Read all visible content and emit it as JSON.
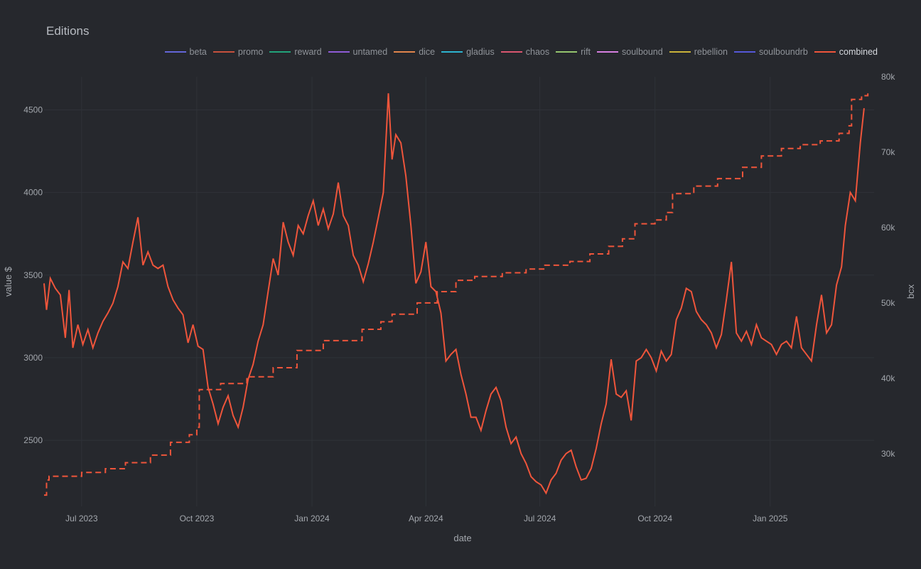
{
  "chart_data": {
    "type": "line",
    "title": "Editions",
    "xlabel": "date",
    "ylabel": "value $",
    "y2label": "bcx",
    "xlim": [
      "2023-06-01",
      "2025-03-25"
    ],
    "ylim": [
      2100,
      4700
    ],
    "y2lim": [
      23000,
      80000
    ],
    "x_ticks": [
      "Jul 2023",
      "Oct 2023",
      "Jan 2024",
      "Apr 2024",
      "Jul 2024",
      "Oct 2024",
      "Jan 2025"
    ],
    "y_ticks": [
      "2500",
      "3000",
      "3500",
      "4000",
      "4500"
    ],
    "y2_ticks": [
      "30k",
      "40k",
      "50k",
      "60k",
      "70k",
      "80k"
    ],
    "grid": true,
    "legend_position": "top-right",
    "legend": [
      {
        "name": "beta",
        "color": "#6366d8"
      },
      {
        "name": "promo",
        "color": "#c7513d"
      },
      {
        "name": "reward",
        "color": "#22a37a"
      },
      {
        "name": "untamed",
        "color": "#8e5bd6"
      },
      {
        "name": "dice",
        "color": "#e0844c"
      },
      {
        "name": "gladius",
        "color": "#2db3cf"
      },
      {
        "name": "chaos",
        "color": "#d9566f"
      },
      {
        "name": "rift",
        "color": "#94c46e"
      },
      {
        "name": "soulbound",
        "color": "#d67fe0"
      },
      {
        "name": "rebellion",
        "color": "#c9b23a"
      },
      {
        "name": "soulboundrb",
        "color": "#5558d8"
      },
      {
        "name": "combined",
        "color": "#ef553b"
      }
    ],
    "series": [
      {
        "name": "combined",
        "axis": "y",
        "style": "solid",
        "color": "#ef553b",
        "points": [
          [
            "2023-06-01",
            3450
          ],
          [
            "2023-06-03",
            3290
          ],
          [
            "2023-06-06",
            3480
          ],
          [
            "2023-06-10",
            3420
          ],
          [
            "2023-06-14",
            3380
          ],
          [
            "2023-06-18",
            3120
          ],
          [
            "2023-06-21",
            3410
          ],
          [
            "2023-06-24",
            3060
          ],
          [
            "2023-06-28",
            3200
          ],
          [
            "2023-07-02",
            3080
          ],
          [
            "2023-07-06",
            3170
          ],
          [
            "2023-07-10",
            3060
          ],
          [
            "2023-07-14",
            3150
          ],
          [
            "2023-07-18",
            3220
          ],
          [
            "2023-07-22",
            3270
          ],
          [
            "2023-07-26",
            3330
          ],
          [
            "2023-07-30",
            3430
          ],
          [
            "2023-08-03",
            3580
          ],
          [
            "2023-08-07",
            3540
          ],
          [
            "2023-08-11",
            3700
          ],
          [
            "2023-08-15",
            3850
          ],
          [
            "2023-08-19",
            3560
          ],
          [
            "2023-08-23",
            3640
          ],
          [
            "2023-08-27",
            3560
          ],
          [
            "2023-08-31",
            3540
          ],
          [
            "2023-09-04",
            3560
          ],
          [
            "2023-09-08",
            3430
          ],
          [
            "2023-09-12",
            3350
          ],
          [
            "2023-09-16",
            3300
          ],
          [
            "2023-09-20",
            3260
          ],
          [
            "2023-09-24",
            3090
          ],
          [
            "2023-09-28",
            3200
          ],
          [
            "2023-10-02",
            3070
          ],
          [
            "2023-10-06",
            3050
          ],
          [
            "2023-10-10",
            2820
          ],
          [
            "2023-10-14",
            2720
          ],
          [
            "2023-10-18",
            2600
          ],
          [
            "2023-10-22",
            2700
          ],
          [
            "2023-10-26",
            2770
          ],
          [
            "2023-10-30",
            2650
          ],
          [
            "2023-11-03",
            2580
          ],
          [
            "2023-11-07",
            2700
          ],
          [
            "2023-11-11",
            2870
          ],
          [
            "2023-11-15",
            2960
          ],
          [
            "2023-11-19",
            3100
          ],
          [
            "2023-11-23",
            3200
          ],
          [
            "2023-11-27",
            3400
          ],
          [
            "2023-12-01",
            3600
          ],
          [
            "2023-12-05",
            3500
          ],
          [
            "2023-12-09",
            3820
          ],
          [
            "2023-12-13",
            3700
          ],
          [
            "2023-12-17",
            3620
          ],
          [
            "2023-12-21",
            3800
          ],
          [
            "2023-12-25",
            3750
          ],
          [
            "2023-12-29",
            3860
          ],
          [
            "2024-01-02",
            3950
          ],
          [
            "2024-01-06",
            3800
          ],
          [
            "2024-01-10",
            3900
          ],
          [
            "2024-01-14",
            3780
          ],
          [
            "2024-01-18",
            3870
          ],
          [
            "2024-01-22",
            4060
          ],
          [
            "2024-01-26",
            3860
          ],
          [
            "2024-01-30",
            3800
          ],
          [
            "2024-02-03",
            3620
          ],
          [
            "2024-02-07",
            3560
          ],
          [
            "2024-02-11",
            3460
          ],
          [
            "2024-02-15",
            3570
          ],
          [
            "2024-02-19",
            3700
          ],
          [
            "2024-02-23",
            3850
          ],
          [
            "2024-02-27",
            4000
          ],
          [
            "2024-03-02",
            4600
          ],
          [
            "2024-03-05",
            4200
          ],
          [
            "2024-03-08",
            4350
          ],
          [
            "2024-03-12",
            4300
          ],
          [
            "2024-03-16",
            4100
          ],
          [
            "2024-03-20",
            3800
          ],
          [
            "2024-03-24",
            3450
          ],
          [
            "2024-03-28",
            3520
          ],
          [
            "2024-04-01",
            3700
          ],
          [
            "2024-04-05",
            3430
          ],
          [
            "2024-04-09",
            3400
          ],
          [
            "2024-04-13",
            3270
          ],
          [
            "2024-04-17",
            2980
          ],
          [
            "2024-04-21",
            3020
          ],
          [
            "2024-04-25",
            3050
          ],
          [
            "2024-04-29",
            2900
          ],
          [
            "2024-05-03",
            2780
          ],
          [
            "2024-05-07",
            2640
          ],
          [
            "2024-05-11",
            2640
          ],
          [
            "2024-05-15",
            2560
          ],
          [
            "2024-05-19",
            2680
          ],
          [
            "2024-05-23",
            2780
          ],
          [
            "2024-05-27",
            2820
          ],
          [
            "2024-05-31",
            2740
          ],
          [
            "2024-06-04",
            2580
          ],
          [
            "2024-06-08",
            2480
          ],
          [
            "2024-06-12",
            2520
          ],
          [
            "2024-06-16",
            2420
          ],
          [
            "2024-06-20",
            2360
          ],
          [
            "2024-06-24",
            2280
          ],
          [
            "2024-06-28",
            2250
          ],
          [
            "2024-07-02",
            2230
          ],
          [
            "2024-07-06",
            2180
          ],
          [
            "2024-07-10",
            2260
          ],
          [
            "2024-07-14",
            2300
          ],
          [
            "2024-07-18",
            2380
          ],
          [
            "2024-07-22",
            2420
          ],
          [
            "2024-07-26",
            2440
          ],
          [
            "2024-07-30",
            2340
          ],
          [
            "2024-08-03",
            2260
          ],
          [
            "2024-08-07",
            2270
          ],
          [
            "2024-08-11",
            2330
          ],
          [
            "2024-08-15",
            2450
          ],
          [
            "2024-08-19",
            2600
          ],
          [
            "2024-08-23",
            2720
          ],
          [
            "2024-08-27",
            2990
          ],
          [
            "2024-08-31",
            2780
          ],
          [
            "2024-09-04",
            2760
          ],
          [
            "2024-09-08",
            2800
          ],
          [
            "2024-09-12",
            2620
          ],
          [
            "2024-09-16",
            2980
          ],
          [
            "2024-09-20",
            3000
          ],
          [
            "2024-09-24",
            3050
          ],
          [
            "2024-09-28",
            3000
          ],
          [
            "2024-10-02",
            2920
          ],
          [
            "2024-10-06",
            3040
          ],
          [
            "2024-10-10",
            2980
          ],
          [
            "2024-10-14",
            3020
          ],
          [
            "2024-10-18",
            3230
          ],
          [
            "2024-10-22",
            3300
          ],
          [
            "2024-10-26",
            3420
          ],
          [
            "2024-10-30",
            3400
          ],
          [
            "2024-11-03",
            3280
          ],
          [
            "2024-11-07",
            3230
          ],
          [
            "2024-11-11",
            3200
          ],
          [
            "2024-11-15",
            3150
          ],
          [
            "2024-11-19",
            3060
          ],
          [
            "2024-11-23",
            3140
          ],
          [
            "2024-11-27",
            3350
          ],
          [
            "2024-12-01",
            3580
          ],
          [
            "2024-12-05",
            3150
          ],
          [
            "2024-12-09",
            3100
          ],
          [
            "2024-12-13",
            3160
          ],
          [
            "2024-12-17",
            3080
          ],
          [
            "2024-12-21",
            3200
          ],
          [
            "2024-12-25",
            3120
          ],
          [
            "2024-12-29",
            3100
          ],
          [
            "2025-01-02",
            3080
          ],
          [
            "2025-01-06",
            3020
          ],
          [
            "2025-01-10",
            3080
          ],
          [
            "2025-01-14",
            3100
          ],
          [
            "2025-01-18",
            3060
          ],
          [
            "2025-01-22",
            3250
          ],
          [
            "2025-01-26",
            3060
          ],
          [
            "2025-01-30",
            3020
          ],
          [
            "2025-02-03",
            2980
          ],
          [
            "2025-02-07",
            3200
          ],
          [
            "2025-02-11",
            3380
          ],
          [
            "2025-02-15",
            3150
          ],
          [
            "2025-02-19",
            3200
          ],
          [
            "2025-02-23",
            3440
          ],
          [
            "2025-02-27",
            3550
          ],
          [
            "2025-03-02",
            3800
          ],
          [
            "2025-03-06",
            4000
          ],
          [
            "2025-03-10",
            3950
          ],
          [
            "2025-03-14",
            4300
          ],
          [
            "2025-03-17",
            4510
          ]
        ]
      },
      {
        "name": "combined",
        "axis": "y2",
        "style": "dashed",
        "color": "#ef553b",
        "points": [
          [
            "2023-06-01",
            24500
          ],
          [
            "2023-06-03",
            26500
          ],
          [
            "2023-06-05",
            27000
          ],
          [
            "2023-07-01",
            27500
          ],
          [
            "2023-07-20",
            28000
          ],
          [
            "2023-08-05",
            28800
          ],
          [
            "2023-08-25",
            29800
          ],
          [
            "2023-09-10",
            31500
          ],
          [
            "2023-09-25",
            32500
          ],
          [
            "2023-10-01",
            33500
          ],
          [
            "2023-10-03",
            38500
          ],
          [
            "2023-10-20",
            39300
          ],
          [
            "2023-11-10",
            40200
          ],
          [
            "2023-12-01",
            41400
          ],
          [
            "2023-12-20",
            43700
          ],
          [
            "2024-01-10",
            45000
          ],
          [
            "2024-02-10",
            46500
          ],
          [
            "2024-02-25",
            47500
          ],
          [
            "2024-03-05",
            48500
          ],
          [
            "2024-03-25",
            50000
          ],
          [
            "2024-04-10",
            51500
          ],
          [
            "2024-04-25",
            53000
          ],
          [
            "2024-05-10",
            53500
          ],
          [
            "2024-06-01",
            54000
          ],
          [
            "2024-06-20",
            54500
          ],
          [
            "2024-07-05",
            55000
          ],
          [
            "2024-07-25",
            55500
          ],
          [
            "2024-08-10",
            56500
          ],
          [
            "2024-08-25",
            57500
          ],
          [
            "2024-09-05",
            58500
          ],
          [
            "2024-09-15",
            60500
          ],
          [
            "2024-10-01",
            61000
          ],
          [
            "2024-10-10",
            62000
          ],
          [
            "2024-10-15",
            64500
          ],
          [
            "2024-11-01",
            65500
          ],
          [
            "2024-11-20",
            66500
          ],
          [
            "2024-12-10",
            68000
          ],
          [
            "2024-12-25",
            69500
          ],
          [
            "2025-01-10",
            70500
          ],
          [
            "2025-01-25",
            71000
          ],
          [
            "2025-02-10",
            71500
          ],
          [
            "2025-02-25",
            72500
          ],
          [
            "2025-03-05",
            73500
          ],
          [
            "2025-03-07",
            77000
          ],
          [
            "2025-03-15",
            77500
          ],
          [
            "2025-03-20",
            78000
          ]
        ]
      }
    ]
  }
}
